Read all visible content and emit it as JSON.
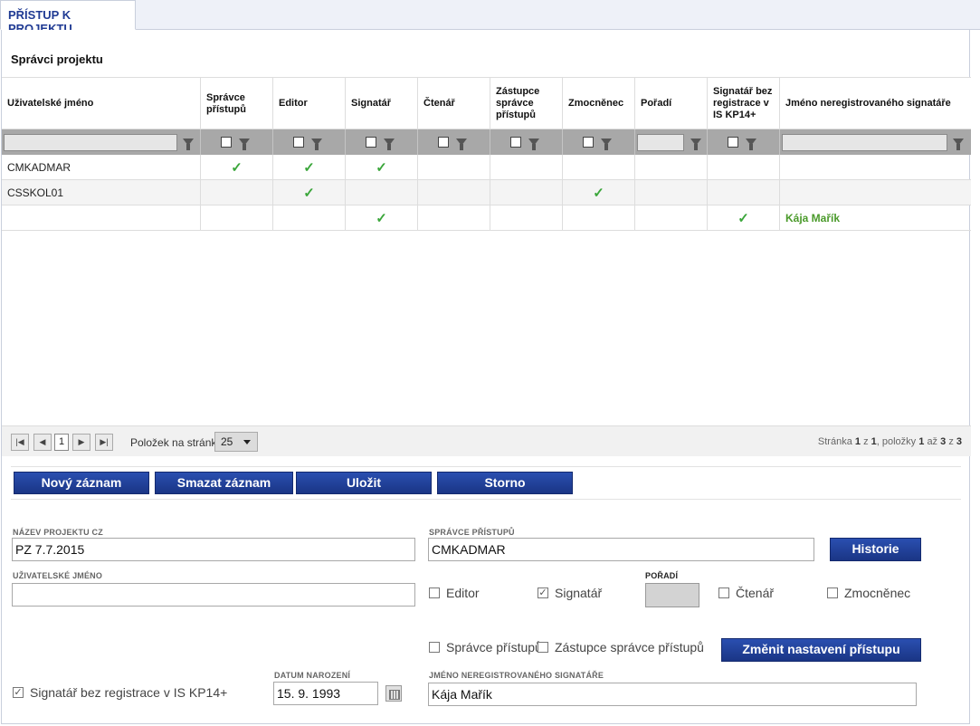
{
  "tab": {
    "title": "PŘÍSTUP K PROJEKTU"
  },
  "section": {
    "title": "Správci projektu"
  },
  "columns": [
    "Uživatelské jméno",
    "Správce přístupů",
    "Editor",
    "Signatář",
    "Čtenář",
    "Zástupce správce přístupů",
    "Zmocněnec",
    "Pořadí",
    "Signatář bez registrace v IS KP14+",
    "Jméno neregistrovaného signatáře"
  ],
  "rows": [
    {
      "user": "CMKADMAR",
      "spravce": true,
      "editor": true,
      "signatar": true,
      "ctenar": false,
      "zastupce": false,
      "zmocnenec": false,
      "poradi": "",
      "bez_registrace": false,
      "jmeno": ""
    },
    {
      "user": "CSSKOL01",
      "spravce": false,
      "editor": true,
      "signatar": false,
      "ctenar": false,
      "zastupce": false,
      "zmocnenec": true,
      "poradi": "",
      "bez_registrace": false,
      "jmeno": ""
    },
    {
      "user": "",
      "spravce": false,
      "editor": false,
      "signatar": true,
      "ctenar": false,
      "zastupce": false,
      "zmocnenec": false,
      "poradi": "",
      "bez_registrace": true,
      "jmeno": "Kája Mařík"
    }
  ],
  "pager": {
    "first": "|◀",
    "prev": "◀",
    "page": "1",
    "next": "▶",
    "last": "▶|",
    "per_page_label": "Položek na stránku",
    "per_page": "25",
    "info_prefix": "Stránka",
    "info_page": "1",
    "info_of": "z",
    "info_pages": "1",
    "info_items": ", položky",
    "info_from": "1",
    "info_to_word": "až",
    "info_to": "3",
    "info_z": "z",
    "info_total": "3"
  },
  "actions": {
    "new": "Nový záznam",
    "delete": "Smazat záznam",
    "save": "Uložit",
    "cancel": "Storno"
  },
  "form": {
    "project_name_label": "NÁZEV PROJEKTU CZ",
    "project_name_value": "PZ 7.7.2015",
    "access_admin_label": "SPRÁVCE PŘÍSTUPŮ",
    "access_admin_value": "CMKADMAR",
    "history_button": "Historie",
    "username_label": "UŽIVATELSKÉ JMÉNO",
    "username_value": "",
    "editor_label": "Editor",
    "editor_checked": false,
    "signatar_label": "Signatář",
    "signatar_checked": true,
    "poradi_label": "POŘADÍ",
    "ctenar_label": "Čtenář",
    "ctenar_checked": false,
    "zmocnenec_label": "Zmocněnec",
    "zmocnenec_checked": false,
    "spravce_label": "Správce přístupů",
    "spravce_checked": false,
    "zastupce_label": "Zástupce správce přístupů",
    "zastupce_checked": false,
    "change_button": "Změnit nastavení přístupu",
    "bez_registrace_label": "Signatář bez registrace v IS KP14+",
    "bez_registrace_checked": true,
    "birth_label": "DATUM NAROZENÍ",
    "birth_value": "15. 9. 1993",
    "unreg_name_label": "JMÉNO NEREGISTROVANÉHO SIGNATÁŘE",
    "unreg_name_value": "Kája Mařík"
  },
  "check_glyph": "✓"
}
